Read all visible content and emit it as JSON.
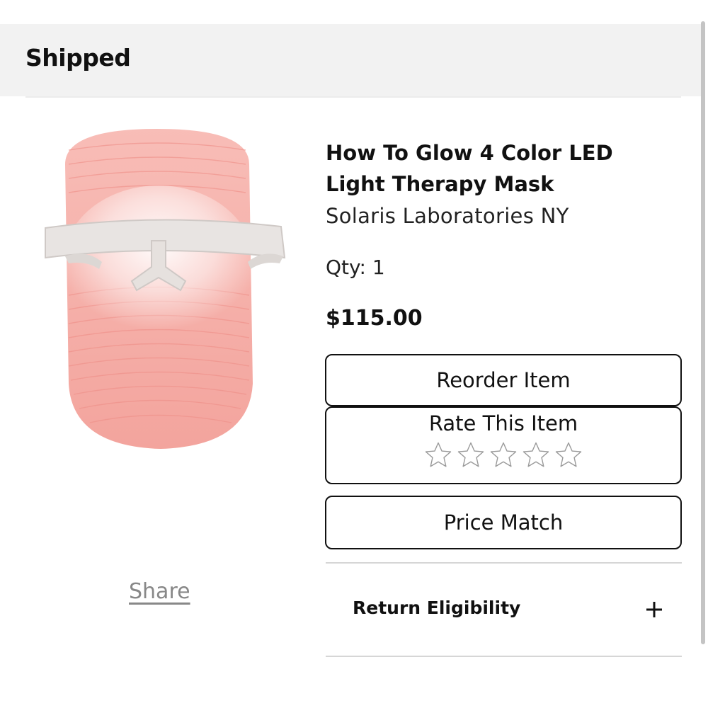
{
  "header": {
    "title": "Shipped"
  },
  "product": {
    "name": "How To Glow 4 Color LED Light Therapy Mask",
    "brand": "Solaris Laboratories NY",
    "qty": "Qty: 1",
    "price": "$115.00",
    "image_icon": "led-face-mask-image",
    "accent_color": "#f4a9a4"
  },
  "actions": {
    "reorder_label": "Reorder Item",
    "rate_label": "Rate This Item",
    "rating": {
      "value": 0,
      "max": 5
    },
    "price_match_label": "Price Match",
    "share_label": "Share"
  },
  "return": {
    "label": "Return Eligibility",
    "icon": "plus-icon"
  },
  "colors": {
    "header_bg": "#f2f2f2",
    "text": "#111111",
    "share": "#888888",
    "border": "#111111"
  }
}
